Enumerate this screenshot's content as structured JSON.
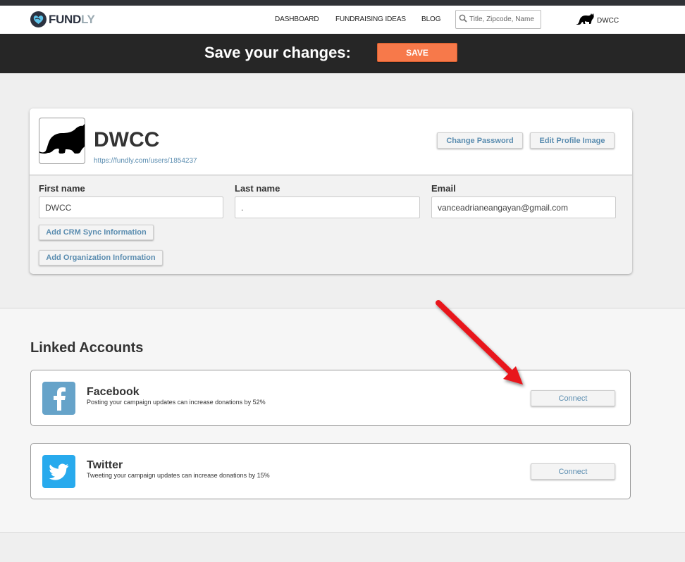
{
  "colors": {
    "accent_orange": "#f7794a",
    "link_blue": "#5b8db0",
    "facebook_blue": "#66a3c9",
    "twitter_blue": "#28aaed",
    "annotation_red": "#e8141a"
  },
  "navbar": {
    "logo": {
      "part1": "FUND",
      "part2": "LY",
      "icon": "fundly-logo-icon"
    },
    "items": [
      {
        "label": "DASHBOARD"
      },
      {
        "label": "FUNDRAISING IDEAS"
      },
      {
        "label": "BLOG"
      }
    ],
    "search": {
      "placeholder": "Title, Zipcode, Name",
      "value": "",
      "icon": "search-icon"
    },
    "user": {
      "name": "DWCC",
      "icon": "cat-avatar-icon"
    }
  },
  "savebar": {
    "text": "Save your changes:",
    "button_label": "SAVE"
  },
  "profile": {
    "name": "DWCC",
    "url": "https://fundly.com/users/1854237",
    "buttons": {
      "change_password": "Change Password",
      "edit_profile_image": "Edit Profile Image",
      "add_crm": "Add CRM Sync Information",
      "add_org": "Add Organization Information"
    },
    "fields": {
      "first_name": {
        "label": "First name",
        "value": "DWCC"
      },
      "last_name": {
        "label": "Last name",
        "value": "."
      },
      "email": {
        "label": "Email",
        "value": "vanceadrianeangayan@gmail.com"
      }
    }
  },
  "linked_accounts": {
    "title": "Linked Accounts",
    "accounts": [
      {
        "name": "Facebook",
        "description": "Posting your campaign updates can increase donations by 52%",
        "button_label": "Connect",
        "icon": "facebook-icon"
      },
      {
        "name": "Twitter",
        "description": "Tweeting your campaign updates can increase donations by 15%",
        "button_label": "Connect",
        "icon": "twitter-icon"
      }
    ]
  }
}
